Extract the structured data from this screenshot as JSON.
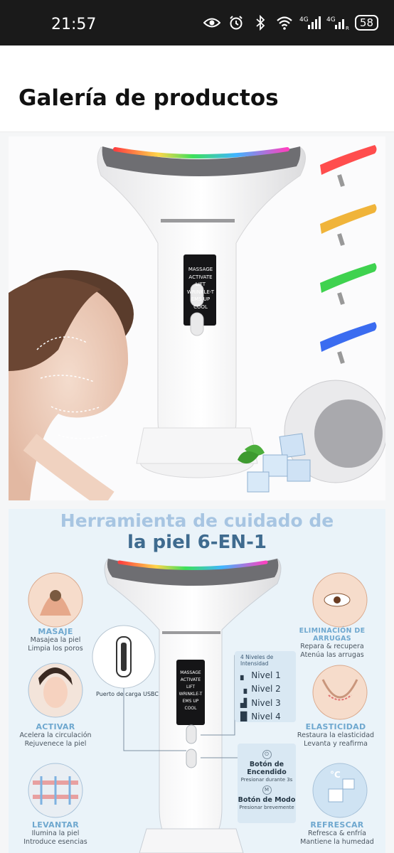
{
  "status_bar": {
    "time": "21:57",
    "battery": "58",
    "network_1": "4G",
    "network_2": "4G"
  },
  "header": {
    "title": "Galería de productos"
  },
  "image1": {
    "device_screen": [
      "MASSAGE",
      "ACTIVATE",
      "LIFT",
      "WRINKLE-T",
      "EMS UP",
      "COOL"
    ]
  },
  "image2": {
    "headline_1": "Herramienta de cuidado de",
    "headline_2": "la piel 6-EN-1",
    "device_screen": [
      "MASSAGE",
      "ACTIVATE",
      "LIFT",
      "WRINKLE-T",
      "EMS UP",
      "COOL"
    ],
    "usb_label": "Puerto de carga USBC",
    "levels_title": "4 Niveles de Intensidad",
    "levels": [
      "Nivel 1",
      "Nivel 2",
      "Nivel 3",
      "Nivel 4"
    ],
    "power_title": "Botón de Encendido",
    "power_sub": "Presionar durante 3s",
    "mode_title": "Botón de Modo",
    "mode_sub": "Presionar brevemente",
    "features": {
      "masaje": {
        "title": "MASAJE",
        "line1": "Masajea la piel",
        "line2": "Limpia los poros"
      },
      "activar": {
        "title": "ACTIVAR",
        "line1": "Acelera la circulación",
        "line2": "Rejuvenece la piel"
      },
      "levantar": {
        "title": "LEVANTAR",
        "line1": "Ilumina la piel",
        "line2": "Introduce esencias"
      },
      "arrugas": {
        "title": "ELIMINACIÓN DE ARRUGAS",
        "line1": "Repara & recupera",
        "line2": "Atenúa las arrugas"
      },
      "elasticidad": {
        "title": "ELASTICIDAD",
        "line1": "Restaura la elasticidad",
        "line2": "Levanta y reafirma"
      },
      "refrescar": {
        "title": "REFRESCAR",
        "line1": "Refresca & enfría",
        "line2": "Mantiene la humedad"
      }
    }
  },
  "colors": {
    "status_bg": "#1a1a1a",
    "accent_blue": "#6fa8cf",
    "headline_dark": "#3f6b8f",
    "headline_light": "#a7c5e2"
  }
}
